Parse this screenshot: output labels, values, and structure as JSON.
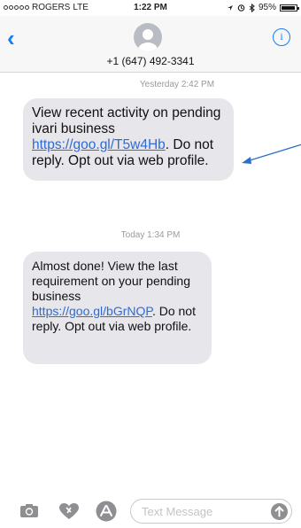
{
  "status_bar": {
    "carrier": "ROGERS",
    "network": "LTE",
    "time": "1:22 PM",
    "battery": "95%",
    "battery_level": 0.95,
    "signal_bars": 0
  },
  "header": {
    "back_icon": "chevron-left-icon",
    "contact": "+1 (647) 492-3341",
    "info_icon": "info-icon",
    "info_glyph": "i"
  },
  "messages": [
    {
      "timestamp_day": "Yesterday",
      "timestamp_time": "2:42 PM",
      "text_before": "View recent activity on pending ivari business ",
      "link": "https://goo.gl/T5w4Hb",
      "text_after": ". Do not reply. Opt out via web profile."
    },
    {
      "timestamp_day": "Today",
      "timestamp_time": "1:34 PM",
      "text_before": "Almost done! View the last requirement on your pending business ",
      "link": "https://goo.gl/bGrNQP",
      "text_after": ". Do not reply. Opt out via web profile."
    }
  ],
  "composer": {
    "placeholder": "Text Message",
    "icons": [
      "camera-icon",
      "digital-touch-heart-icon",
      "app-store-icon",
      "send-arrow-icon"
    ]
  },
  "colors": {
    "accent": "#1a7cf5",
    "bubble": "#e6e6eb",
    "link": "#2d6bd6",
    "annotation_arrow": "#2a6fc9"
  }
}
